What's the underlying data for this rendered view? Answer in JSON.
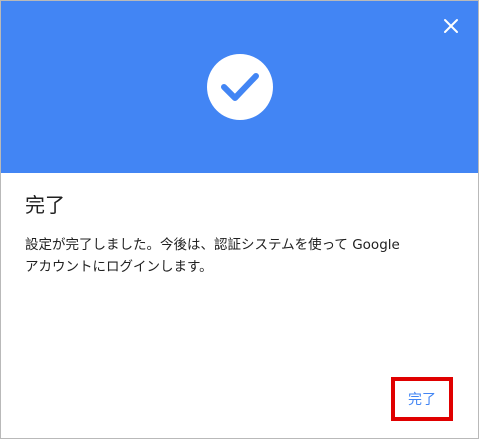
{
  "dialog": {
    "title": "完了",
    "body_line1": "設定が完了しました。今後は、認証システムを使って Google",
    "body_line2": "アカウントにログインします。",
    "done_label": "完了"
  },
  "icons": {
    "close": "close-icon",
    "status": "check-circle-icon"
  },
  "colors": {
    "banner": "#4285f4",
    "accent": "#4285f4",
    "highlight": "#e00000"
  }
}
